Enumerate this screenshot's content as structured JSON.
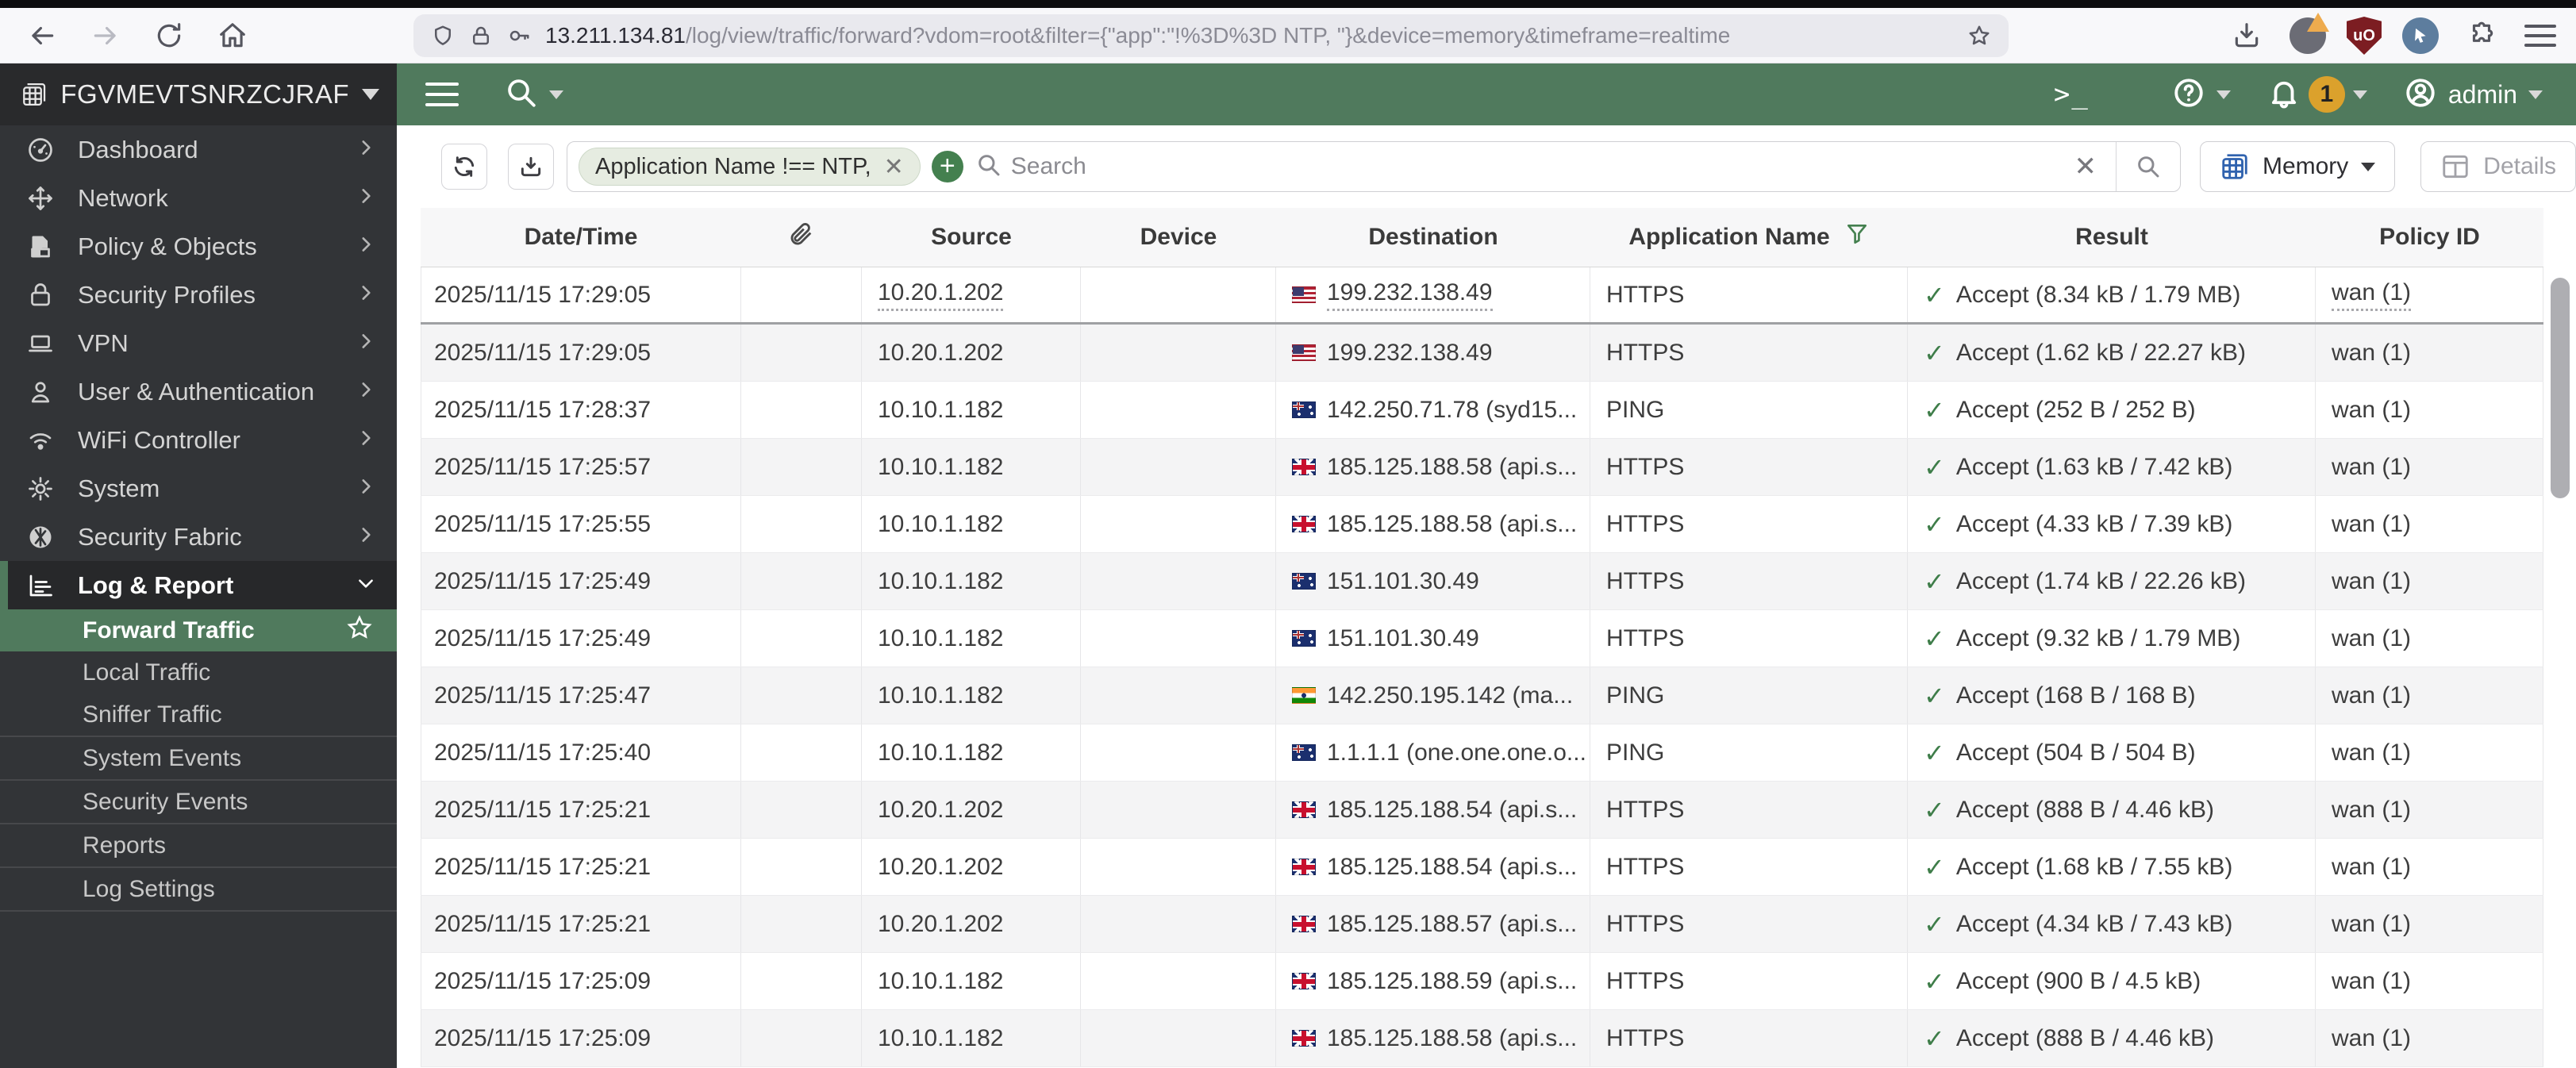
{
  "browser": {
    "url_host": "13.211.134.81",
    "url_path": "/log/view/traffic/forward?vdom=root&filter={\"app\":\"!%3D%3D NTP, \"}&device=memory&timeframe=realtime"
  },
  "header": {
    "hostname": "FGVMEVTSNRZCJRAF",
    "cli_glyph": ">_",
    "notification_count": "1",
    "admin_label": "admin"
  },
  "sidebar": {
    "items": [
      {
        "label": "Dashboard",
        "icon": "gauge"
      },
      {
        "label": "Network",
        "icon": "move"
      },
      {
        "label": "Policy & Objects",
        "icon": "policy"
      },
      {
        "label": "Security Profiles",
        "icon": "lock"
      },
      {
        "label": "VPN",
        "icon": "laptop"
      },
      {
        "label": "User & Authentication",
        "icon": "user"
      },
      {
        "label": "WiFi Controller",
        "icon": "wifi"
      },
      {
        "label": "System",
        "icon": "gear"
      },
      {
        "label": "Security Fabric",
        "icon": "fabric"
      },
      {
        "label": "Log & Report",
        "icon": "logchart",
        "expanded": true,
        "active": true
      }
    ],
    "submenu": [
      {
        "label": "Forward Traffic",
        "selected": true,
        "starred": true
      },
      {
        "label": "Local Traffic"
      },
      {
        "label": "Sniffer Traffic"
      },
      {
        "label": "System Events",
        "divider_before": true
      },
      {
        "label": "Security Events",
        "divider_before": true
      },
      {
        "label": "Reports",
        "divider_before": true
      },
      {
        "label": "Log Settings",
        "divider_before": true,
        "divider_after": true
      }
    ]
  },
  "toolbar": {
    "filter_pill": "Application Name !== NTP,",
    "search_placeholder": "Search",
    "device_selector": "Memory",
    "details_label": "Details"
  },
  "table": {
    "columns": [
      {
        "label": "Date/Time"
      },
      {
        "label": "",
        "icon": "paperclip"
      },
      {
        "label": "Source"
      },
      {
        "label": "Device"
      },
      {
        "label": "Destination"
      },
      {
        "label": "Application Name",
        "icon": "funnel"
      },
      {
        "label": "Result"
      },
      {
        "label": "Policy ID"
      }
    ],
    "rows": [
      {
        "datetime": "2025/11/15 17:29:05",
        "source": "10.20.1.202",
        "device": "",
        "dest_flag": "us",
        "destination": "199.232.138.49",
        "application": "HTTPS",
        "result": "Accept (8.34 kB / 1.79 MB)",
        "policy": "wan (1)",
        "hovered": true
      },
      {
        "datetime": "2025/11/15 17:29:05",
        "source": "10.20.1.202",
        "device": "",
        "dest_flag": "us",
        "destination": "199.232.138.49",
        "application": "HTTPS",
        "result": "Accept (1.62 kB / 22.27 kB)",
        "policy": "wan (1)"
      },
      {
        "datetime": "2025/11/15 17:28:37",
        "source": "10.10.1.182",
        "device": "",
        "dest_flag": "au",
        "destination": "142.250.71.78 (syd15...",
        "application": "PING",
        "result": "Accept (252 B / 252 B)",
        "policy": "wan (1)"
      },
      {
        "datetime": "2025/11/15 17:25:57",
        "source": "10.10.1.182",
        "device": "",
        "dest_flag": "gb",
        "destination": "185.125.188.58 (api.s...",
        "application": "HTTPS",
        "result": "Accept (1.63 kB / 7.42 kB)",
        "policy": "wan (1)"
      },
      {
        "datetime": "2025/11/15 17:25:55",
        "source": "10.10.1.182",
        "device": "",
        "dest_flag": "gb",
        "destination": "185.125.188.58 (api.s...",
        "application": "HTTPS",
        "result": "Accept (4.33 kB / 7.39 kB)",
        "policy": "wan (1)"
      },
      {
        "datetime": "2025/11/15 17:25:49",
        "source": "10.10.1.182",
        "device": "",
        "dest_flag": "au",
        "destination": "151.101.30.49",
        "application": "HTTPS",
        "result": "Accept (1.74 kB / 22.26 kB)",
        "policy": "wan (1)"
      },
      {
        "datetime": "2025/11/15 17:25:49",
        "source": "10.10.1.182",
        "device": "",
        "dest_flag": "au",
        "destination": "151.101.30.49",
        "application": "HTTPS",
        "result": "Accept (9.32 kB / 1.79 MB)",
        "policy": "wan (1)"
      },
      {
        "datetime": "2025/11/15 17:25:47",
        "source": "10.10.1.182",
        "device": "",
        "dest_flag": "in",
        "destination": "142.250.195.142 (ma...",
        "application": "PING",
        "result": "Accept (168 B / 168 B)",
        "policy": "wan (1)"
      },
      {
        "datetime": "2025/11/15 17:25:40",
        "source": "10.10.1.182",
        "device": "",
        "dest_flag": "au",
        "destination": "1.1.1.1 (one.one.one.o...",
        "application": "PING",
        "result": "Accept (504 B / 504 B)",
        "policy": "wan (1)"
      },
      {
        "datetime": "2025/11/15 17:25:21",
        "source": "10.20.1.202",
        "device": "",
        "dest_flag": "gb",
        "destination": "185.125.188.54 (api.s...",
        "application": "HTTPS",
        "result": "Accept (888 B / 4.46 kB)",
        "policy": "wan (1)"
      },
      {
        "datetime": "2025/11/15 17:25:21",
        "source": "10.20.1.202",
        "device": "",
        "dest_flag": "gb",
        "destination": "185.125.188.54 (api.s...",
        "application": "HTTPS",
        "result": "Accept (1.68 kB / 7.55 kB)",
        "policy": "wan (1)"
      },
      {
        "datetime": "2025/11/15 17:25:21",
        "source": "10.20.1.202",
        "device": "",
        "dest_flag": "gb",
        "destination": "185.125.188.57 (api.s...",
        "application": "HTTPS",
        "result": "Accept (4.34 kB / 7.43 kB)",
        "policy": "wan (1)"
      },
      {
        "datetime": "2025/11/15 17:25:09",
        "source": "10.10.1.182",
        "device": "",
        "dest_flag": "gb",
        "destination": "185.125.188.59 (api.s...",
        "application": "HTTPS",
        "result": "Accept (900 B / 4.5 kB)",
        "policy": "wan (1)"
      },
      {
        "datetime": "2025/11/15 17:25:09",
        "source": "10.10.1.182",
        "device": "",
        "dest_flag": "gb",
        "destination": "185.125.188.58 (api.s...",
        "application": "HTTPS",
        "result": "Accept (888 B / 4.46 kB)",
        "policy": "wan (1)"
      }
    ]
  }
}
